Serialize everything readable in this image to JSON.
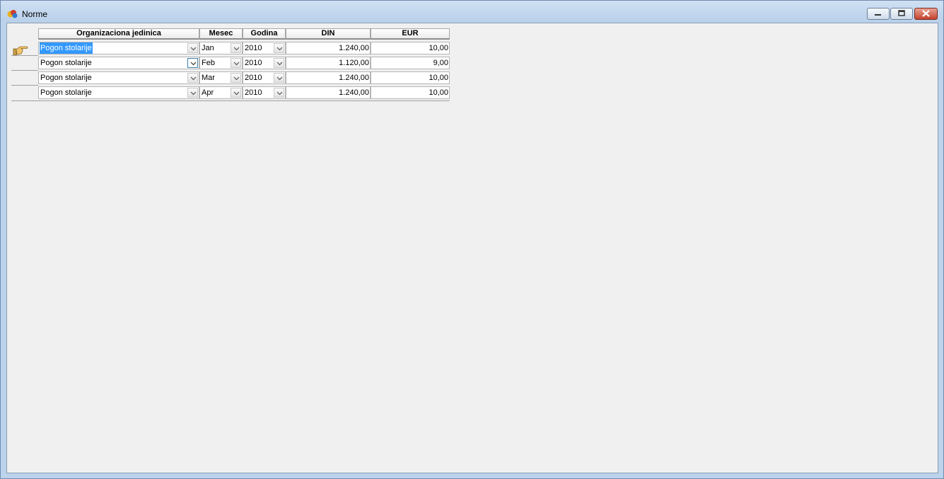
{
  "window": {
    "title": "Norme"
  },
  "grid": {
    "columns": [
      "Organizaciona jedinica",
      "Mesec",
      "Godina",
      "DIN",
      "EUR"
    ],
    "rows": [
      {
        "org": "Pogon stolarije",
        "mesec": "Jan",
        "godina": "2010",
        "din": "1.240,00",
        "eur": "10,00"
      },
      {
        "org": "Pogon stolarije",
        "mesec": "Feb",
        "godina": "2010",
        "din": "1.120,00",
        "eur": "9,00"
      },
      {
        "org": "Pogon stolarije",
        "mesec": "Mar",
        "godina": "2010",
        "din": "1.240,00",
        "eur": "10,00"
      },
      {
        "org": "Pogon stolarije",
        "mesec": "Apr",
        "godina": "2010",
        "din": "1.240,00",
        "eur": "10,00"
      }
    ],
    "current_row_icon": "pointing-hand-icon",
    "selection_color": "#3399ff"
  }
}
